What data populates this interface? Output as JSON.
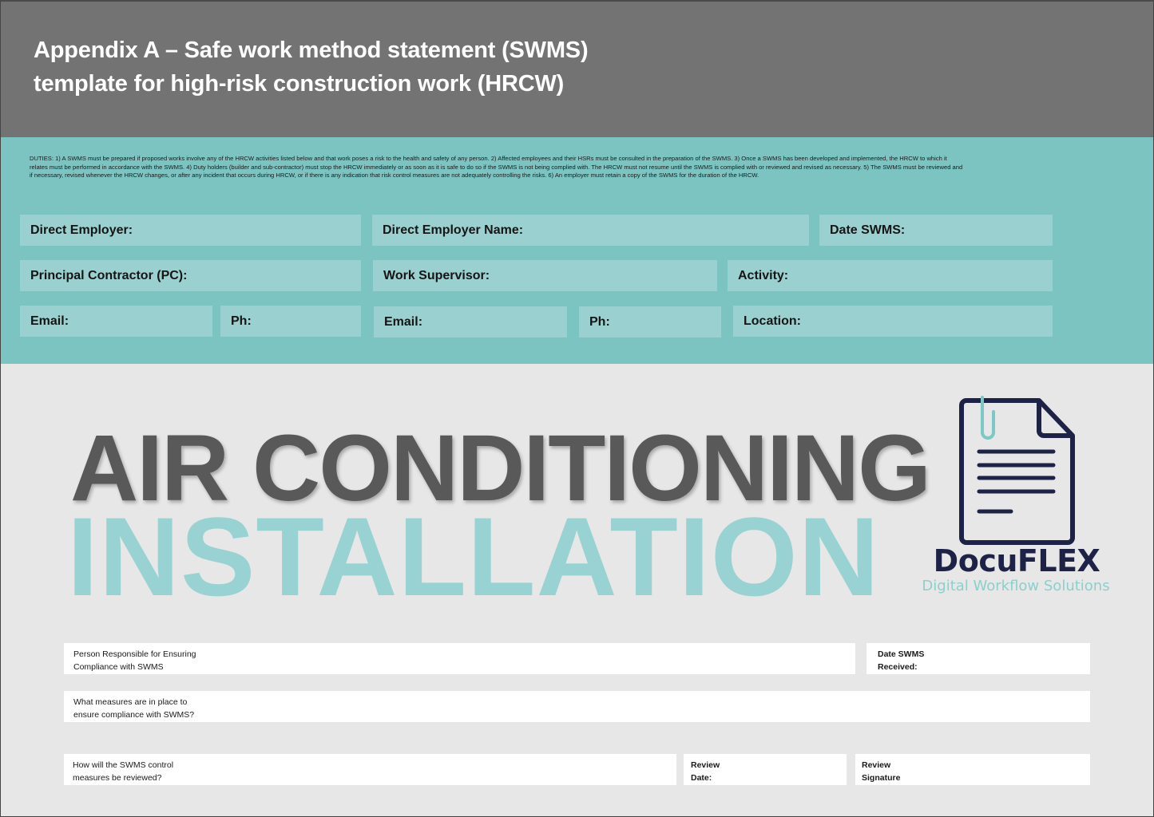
{
  "header": {
    "title_line1": "Appendix A – Safe work method statement (SWMS)",
    "title_line2": "template for high-risk construction work (HRCW)"
  },
  "duties": {
    "text": "DUTIES: 1) A SWMS must be prepared if proposed works involve any of the HRCW activities listed below and that work poses a risk to the health and safety of any person. 2) Affected employees and their HSRs must be consulted in the preparation of the SWMS. 3) Once a SWMS has been developed and implemented, the HRCW to which it relates must be performed in accordance with the SWMS. 4) Duty holders (builder and sub-contractor) must stop the HRCW immediately or as soon as it is safe to do so if the SWMS is not being complied with. The HRCW must not resume until the SWMS is complied with or reviewed and revised as necessary. 5) The SWMS must be reviewed and if necessary, revised whenever the HRCW changes, or after any incident that occurs during HRCW, or if there is any indication that risk control measures are not adequately controlling the risks. 6) An employer must retain a copy of the SWMS for the duration of the HRCW."
  },
  "fields": {
    "direct_employer": "Direct Employer:",
    "direct_employer_name": "Direct Employer Name:",
    "date_swms": "Date SWMS:",
    "principal_contractor": "Principal Contractor (PC):",
    "work_supervisor": "Work Supervisor:",
    "activity": "Activity:",
    "pc_email": "Email:",
    "pc_ph": "Ph:",
    "supervisor_email": "Email:",
    "supervisor_ph": "Ph:",
    "location": "Location:"
  },
  "hero": {
    "line1": "AIR CONDITIONING",
    "line2": "INSTALLATION"
  },
  "logo": {
    "icon": "document-with-paperclip-icon",
    "name": "DocuFLEX",
    "tagline": "Digital Workflow Solutions"
  },
  "bottom_fields": {
    "person_responsible": [
      "Person Responsible for Ensuring",
      "Compliance with SWMS"
    ],
    "date_received": [
      "Date SWMS",
      "Received:"
    ],
    "measures": [
      "What measures are in place to",
      "ensure compliance with SWMS?"
    ],
    "review_how": [
      "How will the SWMS control",
      "measures be reviewed?"
    ],
    "review_date": [
      "Review",
      "Date:"
    ],
    "review_signature": [
      "Review",
      "Signature"
    ]
  },
  "colors": {
    "header_bg": "#737373",
    "teal_bg": "#7bc4c2",
    "field_bg": "#9ad1d0",
    "page_bg": "#e7e7e7",
    "hero_dark": "#595959",
    "hero_teal": "#98d2d2",
    "logo_navy": "#1e2247",
    "logo_teal": "#8ccfcc"
  }
}
